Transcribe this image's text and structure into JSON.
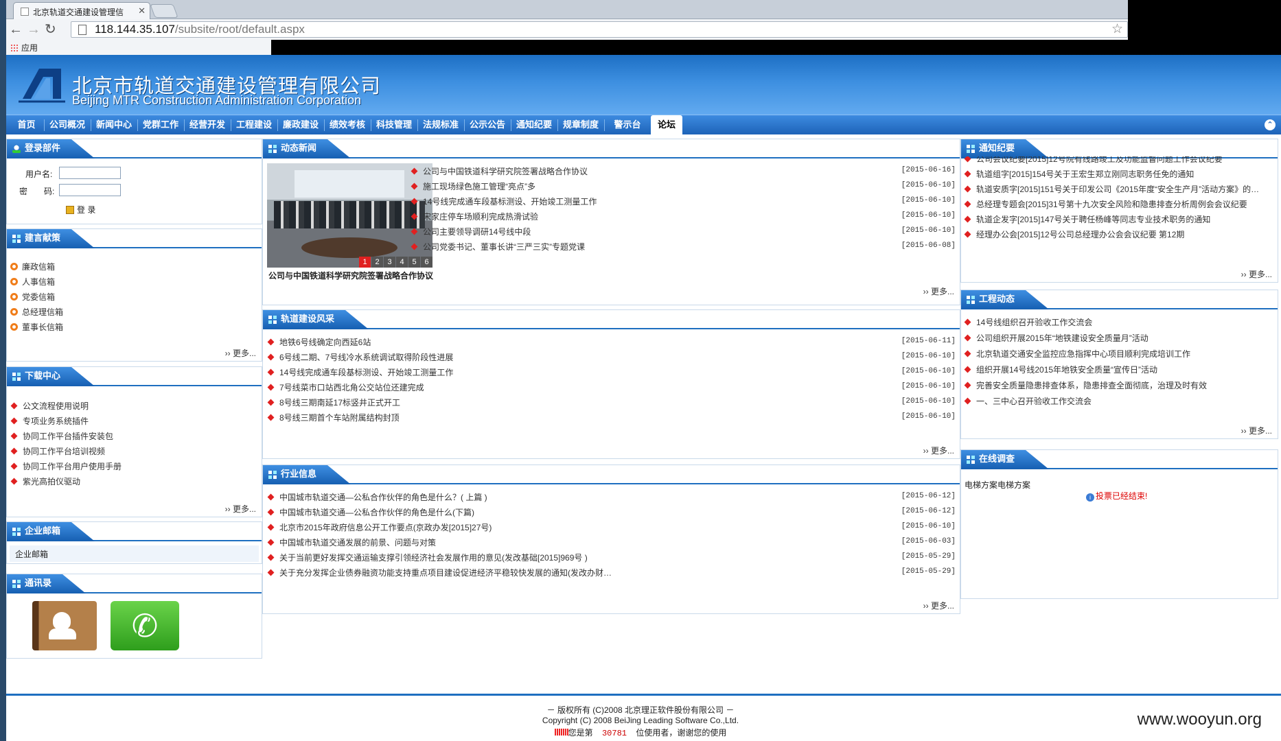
{
  "browser": {
    "tab_title": "北京轨道交通建设管理信",
    "url_host": "118.144.35.107",
    "url_path": "/subsite/root/default.aspx",
    "bookmark_apps": "应用"
  },
  "site": {
    "name_cn": "北京市轨道交通建设管理有限公司",
    "name_en": "Beijing MTR Construction Administration Corporation"
  },
  "nav": [
    "首页",
    "公司概况",
    "新闻中心",
    "党群工作",
    "经营开发",
    "工程建设",
    "廉政建设",
    "绩效考核",
    "科技管理",
    "法规标准",
    "公示公告",
    "通知纪要",
    "规章制度",
    "警示台",
    "论坛"
  ],
  "login": {
    "title": "登录部件",
    "username_label": "用户名:",
    "password_label": "密　　码:",
    "login_button": "登 录"
  },
  "advice": {
    "title": "建言献策",
    "items": [
      "廉政信箱",
      "人事信箱",
      "党委信箱",
      "总经理信箱",
      "董事长信箱"
    ],
    "more": "›› 更多..."
  },
  "download": {
    "title": "下载中心",
    "items": [
      "公文流程使用说明",
      "专项业务系统插件",
      "协同工作平台插件安装包",
      "协同工作平台培训视频",
      "协同工作平台用户使用手册",
      "紫光高拍仪驱动"
    ],
    "more": "›› 更多..."
  },
  "mail": {
    "title": "企业邮箱",
    "link": "企业邮箱"
  },
  "contacts": {
    "title": "通讯录"
  },
  "news": {
    "title": "动态新闻",
    "caption": "公司与中国铁道科学研究院签署战略合作协议",
    "pager": [
      "1",
      "2",
      "3",
      "4",
      "5",
      "6"
    ],
    "items": [
      {
        "text": "公司与中国铁道科学研究院签署战略合作协议",
        "date": "[2015-06-16]"
      },
      {
        "text": "施工现场绿色施工管理“亮点”多",
        "date": "[2015-06-10]"
      },
      {
        "text": "14号线完成通车段基标测设、开始竣工测量工作",
        "date": "[2015-06-10]"
      },
      {
        "text": "宋家庄停车场顺利完成热滑试验",
        "date": "[2015-06-10]"
      },
      {
        "text": "公司主要领导调研14号线中段",
        "date": "[2015-06-10]"
      },
      {
        "text": "公司党委书记、董事长讲“三严三实”专题党课",
        "date": "[2015-06-08]"
      }
    ],
    "more": "›› 更多..."
  },
  "style": {
    "title": "轨道建设风采",
    "items": [
      {
        "text": "地铁6号线确定向西延6站",
        "date": "[2015-06-11]"
      },
      {
        "text": "6号线二期、7号线冷水系统调试取得阶段性进展",
        "date": "[2015-06-10]"
      },
      {
        "text": "14号线完成通车段基标测设、开始竣工测量工作",
        "date": "[2015-06-10]"
      },
      {
        "text": "7号线菜市口站西北角公交站位还建完成",
        "date": "[2015-06-10]"
      },
      {
        "text": "8号线三期南延17标竖井正式开工",
        "date": "[2015-06-10]"
      },
      {
        "text": "8号线三期首个车站附属结构封顶",
        "date": "[2015-06-10]"
      }
    ],
    "more": "›› 更多..."
  },
  "industry": {
    "title": "行业信息",
    "items": [
      {
        "text": "中国城市轨道交通—公私合作伙伴的角色是什么？( 上篇 )",
        "date": "[2015-06-12]"
      },
      {
        "text": "中国城市轨道交通—公私合作伙伴的角色是什么(下篇)",
        "date": "[2015-06-12]"
      },
      {
        "text": "北京市2015年政府信息公开工作要点(京政办发[2015]27号)",
        "date": "[2015-06-10]"
      },
      {
        "text": "中国城市轨道交通发展的前景、问题与对策",
        "date": "[2015-06-03]"
      },
      {
        "text": "关于当前更好发挥交通运输支撑引领经济社会发展作用的意见(发改基础[2015]969号 )",
        "date": "[2015-05-29]"
      },
      {
        "text": "关于充分发挥企业债券融资功能支持重点项目建设促进经济平稳较快发展的通知(发改办财…",
        "date": "[2015-05-29]"
      }
    ],
    "more": "›› 更多..."
  },
  "notice": {
    "title": "通知纪要",
    "items": [
      "公司会议纪要[2015]12号院有线路竣工及功能监督问题工作会议纪要",
      "轨道组字[2015]154号关于王宏生郑立刚同志职务任免的通知",
      "轨道安质字[2015]151号关于印发公司《2015年度“安全生产月”活动方案》的…",
      "总经理专题会[2015]31号第十九次安全风险和隐患排查分析周例会会议纪要",
      "轨道企发字[2015]147号关于聘任杨峰等同志专业技术职务的通知",
      "经理办公会[2015]12号公司总经理办公会会议纪要 第12期"
    ],
    "more": "›› 更多..."
  },
  "project": {
    "title": "工程动态",
    "items": [
      "14号线组织召开验收工作交流会",
      "公司组织开展2015年“地铁建设安全质量月”活动",
      "北京轨道交通安全监控应急指挥中心项目顺利完成培训工作",
      "组织开展14号线2015年地铁安全质量“宣传日”活动",
      "完善安全质量隐患排查体系，隐患排查全面彻底，治理及时有效",
      "一、三中心召开验收工作交流会"
    ],
    "more": "›› 更多..."
  },
  "survey": {
    "title": "在线调查",
    "question": "电梯方案电梯方案",
    "status": "投票已经结束!"
  },
  "footer": {
    "line1": "－ 版权所有 (C)2008 北京理正软件股份有限公司 －",
    "line2": "Copyright (C) 2008 BeiJing Leading Software Co.,Ltd.",
    "visitor_prefix": "您是第",
    "visitor_count": "30781",
    "visitor_suffix": "位使用者，谢谢您的使用"
  },
  "watermark": "www.wooyun.org",
  "colors": {
    "header_blue": "#1d6fc4",
    "nav_blue": "#1d63b8",
    "bullet_red": "#e02020",
    "bullet_orange": "#f07d1a"
  }
}
